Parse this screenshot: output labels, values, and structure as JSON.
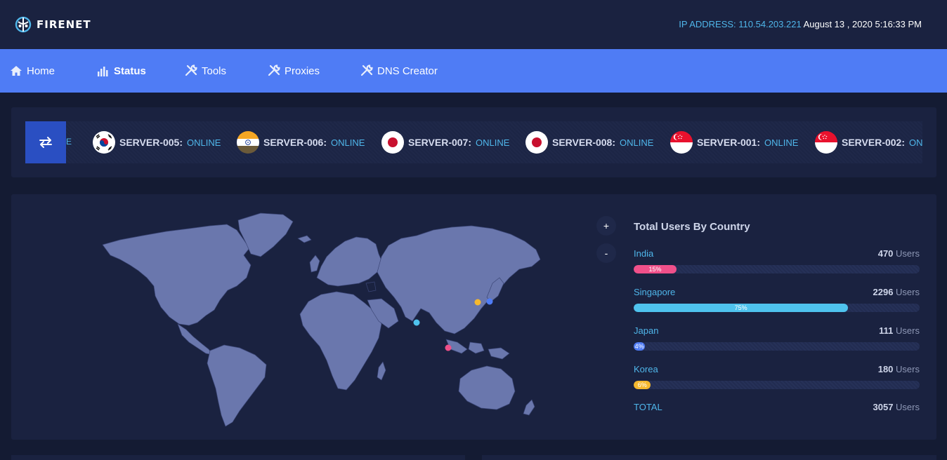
{
  "header": {
    "brand": "FIRENET",
    "ip_label": "IP ADDRESS: 110.54.203.221",
    "datetime": "August 13 , 2020 5:16:33 PM"
  },
  "nav": [
    {
      "label": "Home",
      "icon": "home-icon"
    },
    {
      "label": "Status",
      "icon": "bar-chart-icon"
    },
    {
      "label": "Tools",
      "icon": "tools-icon"
    },
    {
      "label": "Proxies",
      "icon": "tools-icon"
    },
    {
      "label": "DNS Creator",
      "icon": "tools-icon"
    }
  ],
  "ticker": {
    "cut_text": "E",
    "servers": [
      {
        "name": "SERVER-005:",
        "status": "ONLINE",
        "flag": "korea-flag-icon"
      },
      {
        "name": "SERVER-006:",
        "status": "ONLINE",
        "flag": "india-flag-icon"
      },
      {
        "name": "SERVER-007:",
        "status": "ONLINE",
        "flag": "japan-flag-icon"
      },
      {
        "name": "SERVER-008:",
        "status": "ONLINE",
        "flag": "japan-flag-icon"
      },
      {
        "name": "SERVER-001:",
        "status": "ONLINE",
        "flag": "singapore-flag-icon"
      },
      {
        "name": "SERVER-002:",
        "status": "ONLINE",
        "flag": "singapore-flag-icon"
      }
    ]
  },
  "map": {
    "zoom_in": "+",
    "zoom_out": "-",
    "land_color": "#6a77ad"
  },
  "stats": {
    "title": "Total Users By Country",
    "rows": [
      {
        "country": "India",
        "count": "470",
        "unit": "Users",
        "percent_label": "15%",
        "percent": 15,
        "color": "#f0508a"
      },
      {
        "country": "Singapore",
        "count": "2296",
        "unit": "Users",
        "percent_label": "75%",
        "percent": 75,
        "color": "#4fc3ee"
      },
      {
        "country": "Japan",
        "count": "111",
        "unit": "Users",
        "percent_label": "4%",
        "percent": 4,
        "color": "#4f7cf5"
      },
      {
        "country": "Korea",
        "count": "180",
        "unit": "Users",
        "percent_label": "6%",
        "percent": 6,
        "color": "#f5b82e"
      }
    ],
    "total_label": "TOTAL",
    "total_count": "3057",
    "total_unit": "Users"
  }
}
